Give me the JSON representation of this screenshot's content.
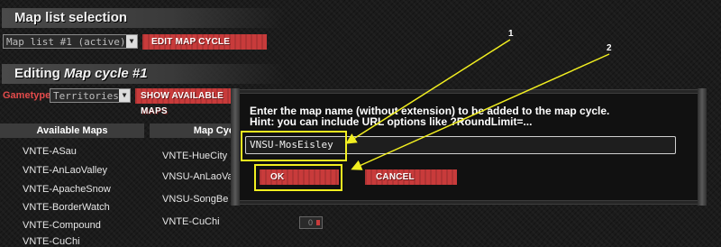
{
  "header": {
    "map_list_title": "Map list selection",
    "map_list_select": "Map list #1 (active)",
    "edit_map_cycle": "EDIT MAP CYCLE",
    "editing_prefix": "Editing",
    "editing_target": "Map cycle #1",
    "gametype_label": "Gametype",
    "gametype_value": "Territories",
    "show_available_maps": "SHOW AVAILABLE MAPS"
  },
  "table": {
    "available_header": "Available Maps",
    "cycle_header": "Map Cyc",
    "available_maps": [
      "VNTE-ASau",
      "VNTE-AnLaoValley",
      "VNTE-ApacheSnow",
      "VNTE-BorderWatch",
      "VNTE-Compound",
      "VNTE-CuChi"
    ],
    "cycle_maps": [
      "VNTE-HueCity",
      "VNSU-AnLaoValley",
      "VNSU-SongBe",
      "VNTE-CuChi"
    ],
    "cycle_number": "0"
  },
  "dialog": {
    "line1": "Enter the map name (without extension) to be added to the map cycle.",
    "line2": "Hint: you can include URL options like ?RoundLimit=...",
    "input_value": "VNSU-MosEisley",
    "ok_label": "OK",
    "cancel_label": "CANCEL"
  },
  "annotations": {
    "callout_1": "1",
    "callout_2": "2",
    "highlight_color": "#f2ef20"
  }
}
